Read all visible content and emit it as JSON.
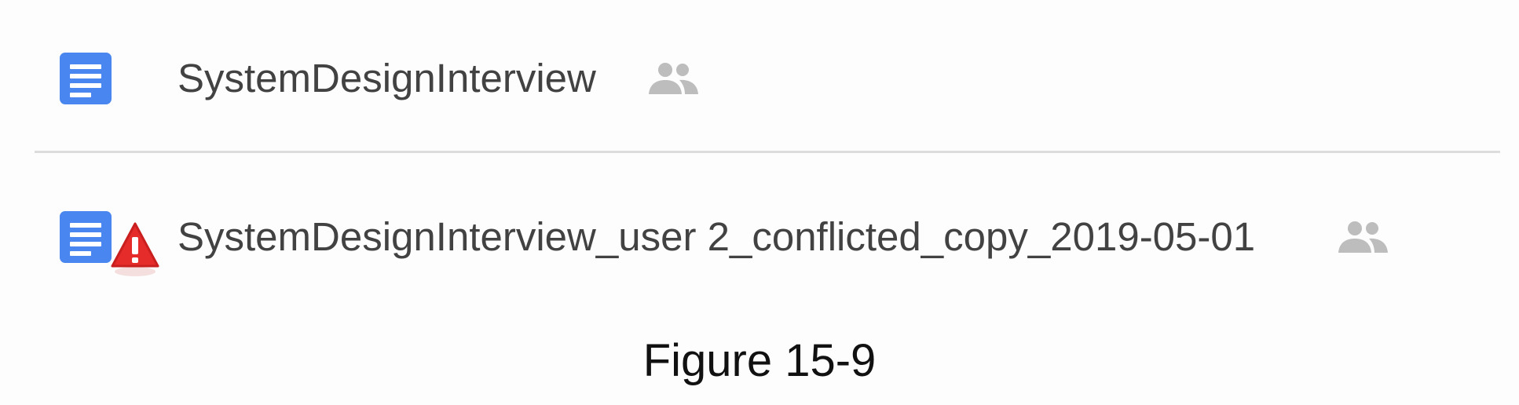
{
  "files": [
    {
      "name": "SystemDesignInterview",
      "icon": "google-doc-icon",
      "shared_icon": "shared-people-icon",
      "conflict": false
    },
    {
      "name": "SystemDesignInterview_user 2_conflicted_copy_2019-05-01",
      "icon": "google-doc-icon",
      "status_icon": "warning-icon",
      "shared_icon": "shared-people-icon",
      "conflict": true
    }
  ],
  "caption": "Figure 15-9",
  "colors": {
    "doc_blue": "#4a86f0",
    "warning_red": "#e52c2a",
    "shared_gray": "#bdbdbd",
    "text": "#424242",
    "divider": "#dddddd"
  }
}
